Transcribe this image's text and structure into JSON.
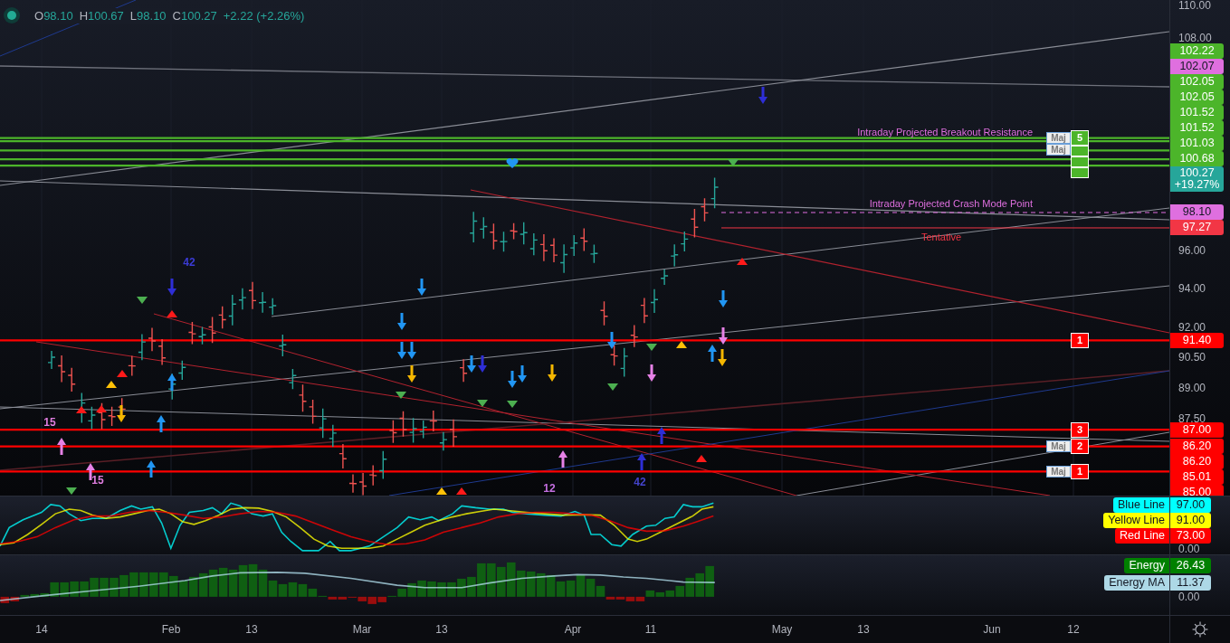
{
  "legend": {
    "items": [
      {
        "label": "O",
        "value": "98.10"
      },
      {
        "label": "H",
        "value": "100.67"
      },
      {
        "label": "L",
        "value": "98.10"
      },
      {
        "label": "C",
        "value": "100.27"
      }
    ],
    "change": "+2.22 (+2.26%)"
  },
  "price_axis": {
    "ticks": [
      "110.00",
      "108.00",
      "96.00",
      "94.00",
      "92.00",
      "90.50",
      "89.00",
      "87.50"
    ],
    "labels": [
      {
        "kind": "level",
        "value": "102.22",
        "color": "#4cb52a",
        "boxed": true,
        "badge": "5",
        "tag": "Maj"
      },
      {
        "kind": "projection",
        "value": "102.07",
        "color": "#df6fdf",
        "boxed": false,
        "note": "Intraday Projected Breakout Resistance"
      },
      {
        "kind": "level",
        "value": "102.05",
        "color": "#4cb52a",
        "boxed": true,
        "tag": "Maj"
      },
      {
        "kind": "level",
        "value": "102.05",
        "color": "#4cb52a",
        "boxed": false
      },
      {
        "kind": "level",
        "value": "101.52",
        "color": "#4cb52a",
        "boxed": true
      },
      {
        "kind": "level",
        "value": "101.52",
        "color": "#4cb52a",
        "boxed": false
      },
      {
        "kind": "level",
        "value": "101.03",
        "color": "#4cb52a",
        "boxed": true
      },
      {
        "kind": "level",
        "value": "100.68",
        "color": "#4cb52a",
        "boxed": false
      },
      {
        "kind": "last",
        "value": "100.27",
        "change": "+19.27%",
        "color": "#26a69a",
        "boxed": false
      },
      {
        "kind": "projection",
        "value": "98.10",
        "color": "#df6fdf",
        "boxed": false,
        "note": "Intraday Projected Crash Mode Point"
      },
      {
        "kind": "tentative",
        "value": "97.27",
        "color": "#f23645",
        "boxed": false,
        "note": "Tentative"
      },
      {
        "kind": "level",
        "value": "91.40",
        "color": "#ff0000",
        "boxed": true,
        "badge": "1"
      },
      {
        "kind": "level",
        "value": "87.00",
        "color": "#ff0000",
        "boxed": true,
        "badge": "3"
      },
      {
        "kind": "level",
        "value": "86.20",
        "color": "#ff0000",
        "boxed": true,
        "badge": "2",
        "tag": "Maj"
      },
      {
        "kind": "level",
        "value": "86.20",
        "color": "#ff0000",
        "boxed": false
      },
      {
        "kind": "level",
        "value": "85.01",
        "color": "#ff0000",
        "boxed": true,
        "badge": "1",
        "tag": "Maj"
      },
      {
        "kind": "level",
        "value": "85.00",
        "color": "#ff0000",
        "boxed": false
      }
    ]
  },
  "signal_labels": [
    {
      "text": "42",
      "color": "#3b3bd6"
    },
    {
      "text": "15",
      "color": "#e07ee0"
    },
    {
      "text": "15",
      "color": "#e07ee0"
    },
    {
      "text": "12",
      "color": "#c46fe0"
    },
    {
      "text": "42",
      "color": "#4444cc"
    }
  ],
  "oscillator": {
    "labels": [
      {
        "name": "Blue Line",
        "value": "97.00",
        "color": "#00ffff"
      },
      {
        "name": "Yellow Line",
        "value": "91.00",
        "color": "#ffff00"
      },
      {
        "name": "Red Line",
        "value": "73.00",
        "color": "#ff0000"
      }
    ],
    "tick": "0.00"
  },
  "energy": {
    "labels": [
      {
        "name": "Energy",
        "value": "26.43",
        "color": "#008000"
      },
      {
        "name": "Energy MA",
        "value": "11.37",
        "color": "#add8e6"
      }
    ],
    "tick": "0.00"
  },
  "time_axis": {
    "labels": [
      "14",
      "Feb",
      "13",
      "Mar",
      "13",
      "Apr",
      "11",
      "May",
      "13",
      "Jun",
      "12"
    ]
  }
}
